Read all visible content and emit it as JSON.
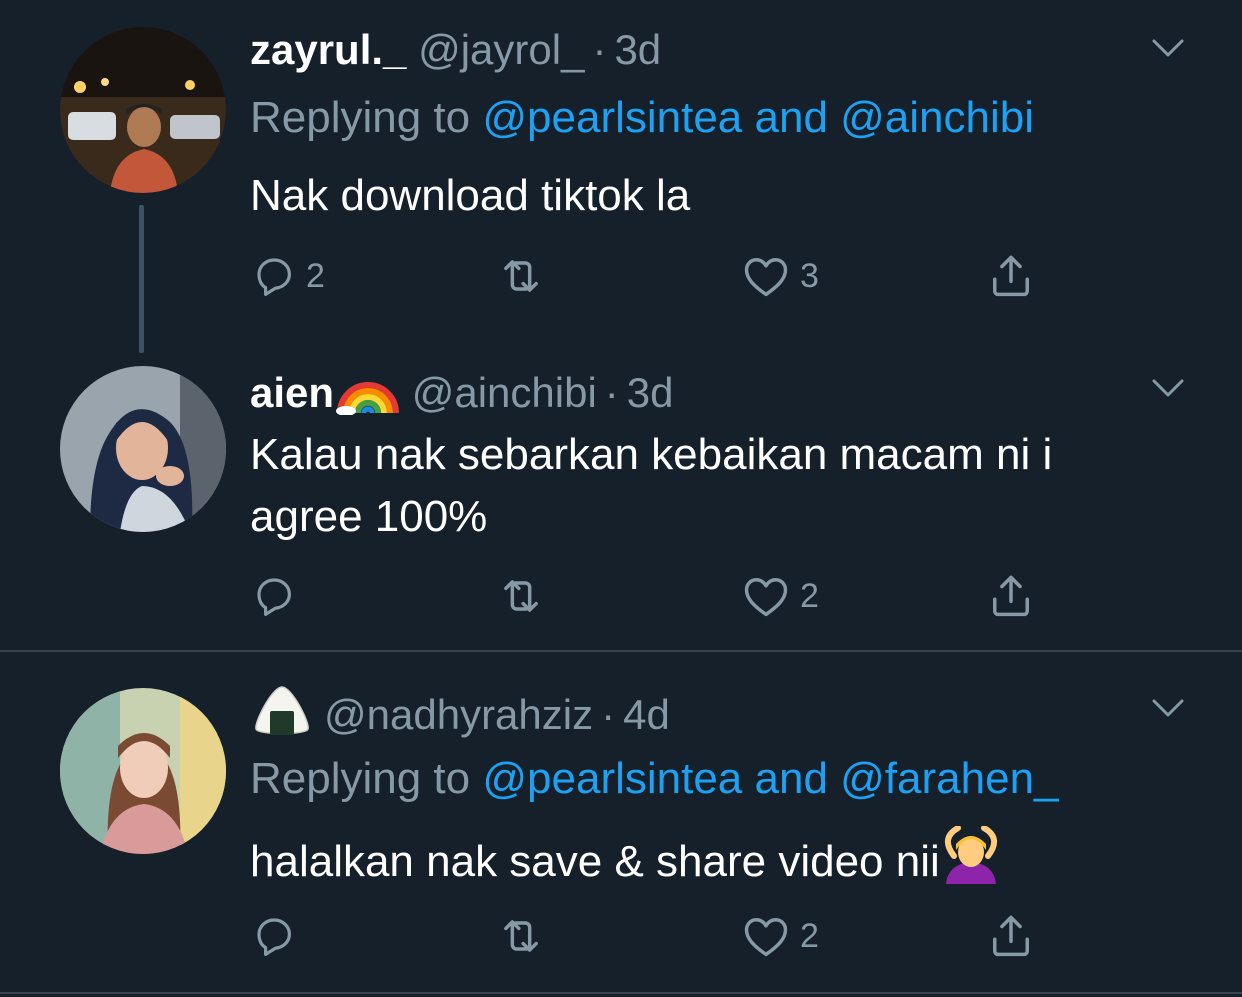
{
  "tweets": [
    {
      "name": "zayrul._",
      "handle": "@jayrol_",
      "dot": "·",
      "time": "3d",
      "reply_prefix": "Replying to ",
      "reply_to": "@pearlsintea and @ainchibi",
      "text": "Nak download tiktok la",
      "actions": {
        "reply_count": "2",
        "retweet_count": "",
        "like_count": "3"
      }
    },
    {
      "name": "aien",
      "name_emoji": "rainbow-emoji",
      "handle": "@ainchibi",
      "dot": "·",
      "time": "3d",
      "text": "Kalau nak sebarkan kebaikan macam ni i agree 100%",
      "actions": {
        "reply_count": "",
        "retweet_count": "",
        "like_count": "2"
      }
    },
    {
      "name_emoji": "rice-ball-emoji",
      "handle": "@nadhyrahziz",
      "dot": "·",
      "time": "4d",
      "reply_prefix": "Replying to ",
      "reply_to": "@pearlsintea and @farahen_",
      "text": "halalkan nak save & share video nii",
      "text_emoji": "person-gesturing-ok-emoji",
      "actions": {
        "reply_count": "",
        "retweet_count": "",
        "like_count": "2"
      }
    }
  ],
  "icons": {
    "reply": "reply-icon",
    "retweet": "retweet-icon",
    "like": "heart-icon",
    "share": "share-icon",
    "menu": "chevron-down-icon"
  },
  "colors": {
    "background": "#15202b",
    "secondary_text": "#8899a6",
    "link": "#1da1f2",
    "divider": "#38444d"
  }
}
